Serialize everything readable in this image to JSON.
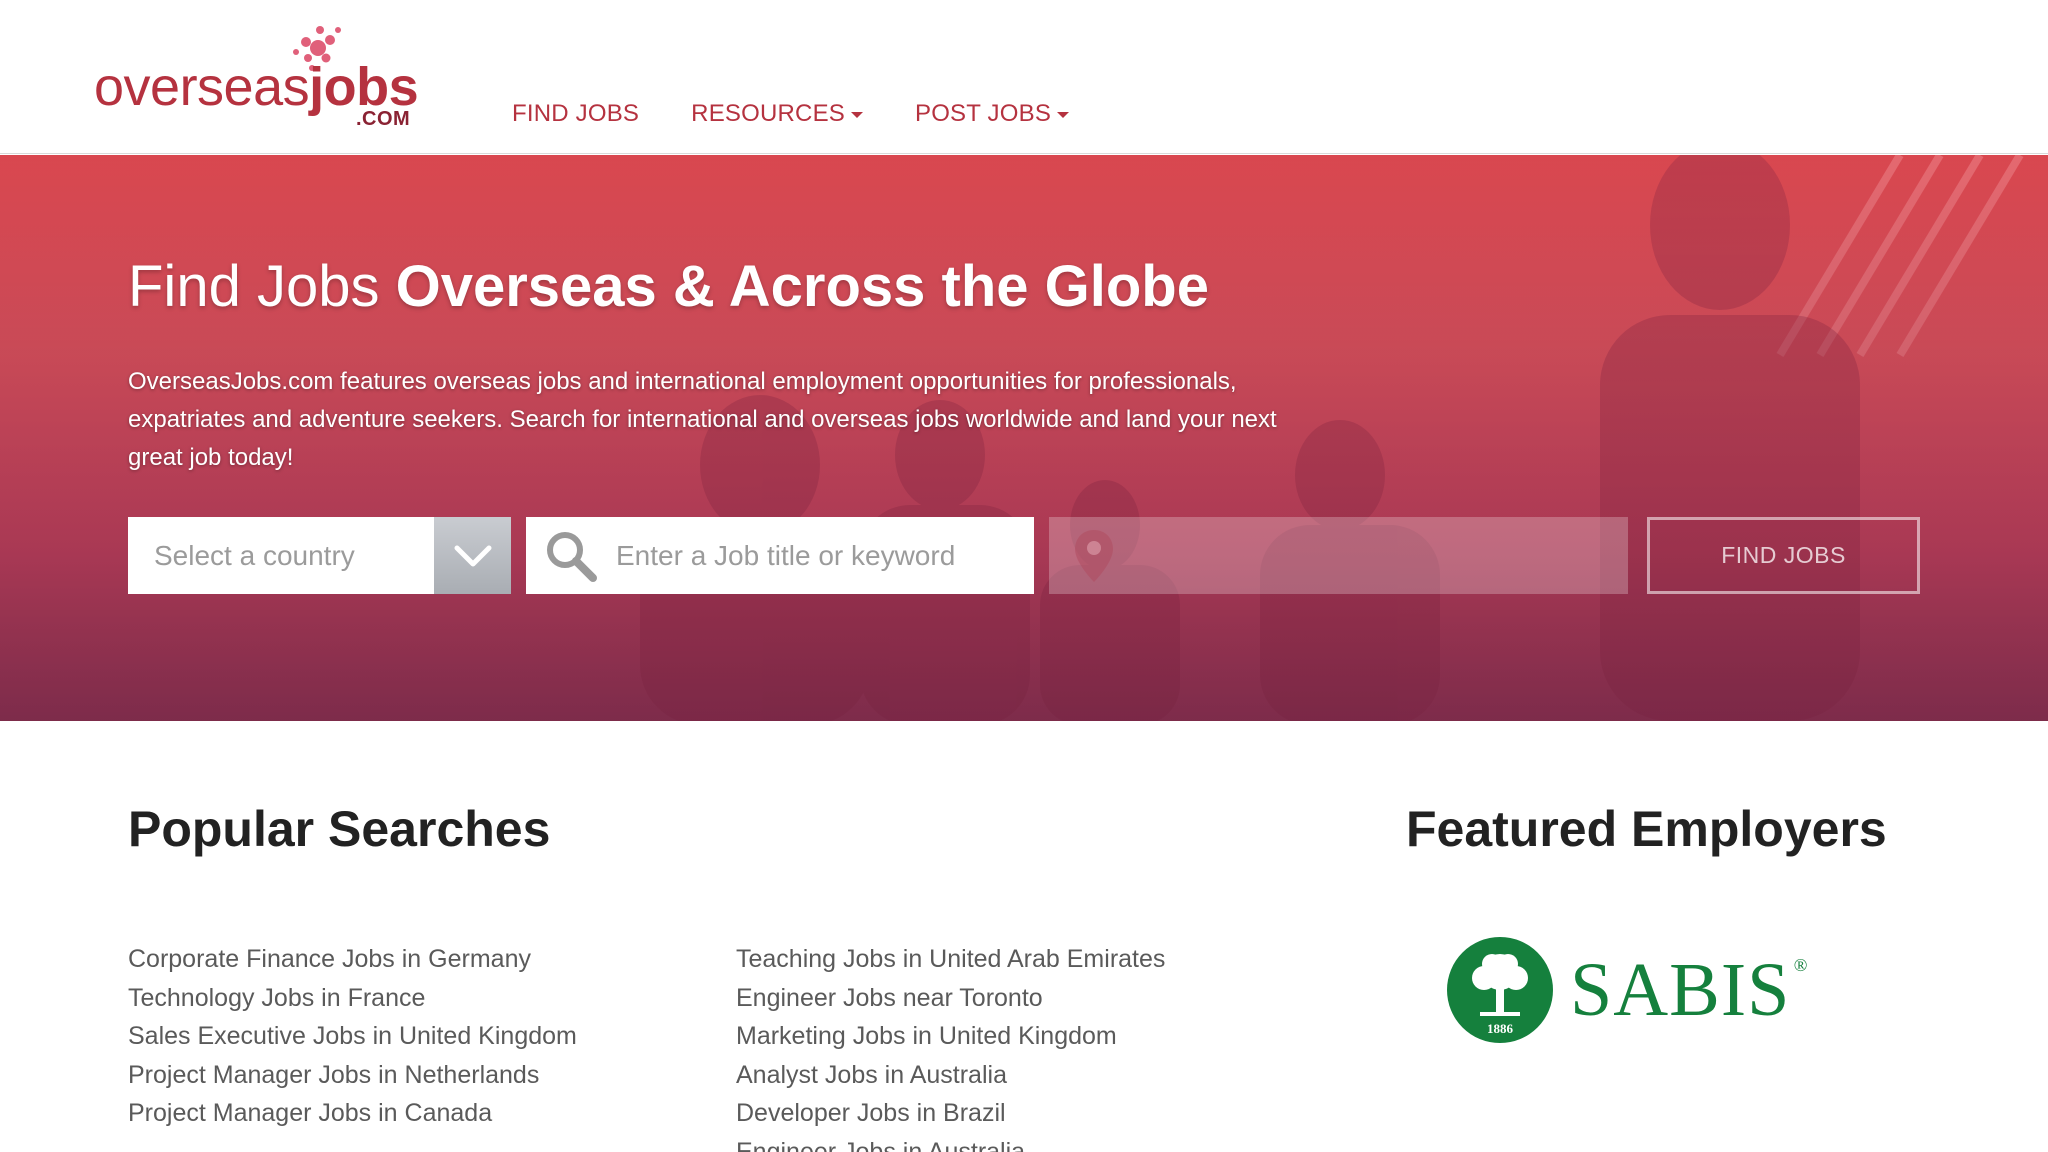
{
  "brand": {
    "logo_part1": "overseas",
    "logo_part2": "jobs",
    "logo_suffix": ".COM",
    "color": "#b5323f"
  },
  "nav": {
    "find_jobs": "FIND JOBS",
    "resources": "RESOURCES",
    "post_jobs": "POST JOBS"
  },
  "hero": {
    "title_light": "Find Jobs ",
    "title_bold": "Overseas & Across the Globe",
    "description": "OverseasJobs.com features overseas jobs and international employment opportunities for professionals, expatriates and adventure seekers. Search for international and overseas jobs worldwide and land your next great job today!",
    "country_select": "Select a country",
    "keyword_placeholder": "Enter a Job title or keyword",
    "location_placeholder": "",
    "find_button": "FIND JOBS",
    "accent_color": "#d9474f"
  },
  "popular": {
    "title": "Popular Searches",
    "column1": [
      "Corporate Finance Jobs in Germany",
      "Technology Jobs in France",
      "Sales Executive Jobs in United Kingdom",
      "Project Manager Jobs in Netherlands",
      "Project Manager Jobs in Canada"
    ],
    "column2": [
      "Teaching Jobs in United Arab Emirates",
      "Engineer Jobs near Toronto",
      "Marketing Jobs in United Kingdom",
      "Analyst Jobs in Australia",
      "Developer Jobs in Brazil",
      "Engineer Jobs in Australia"
    ]
  },
  "featured": {
    "title": "Featured Employers",
    "employer_name": "SABIS",
    "employer_reg": "®",
    "employer_year": "1886",
    "employer_color": "#15803d"
  }
}
